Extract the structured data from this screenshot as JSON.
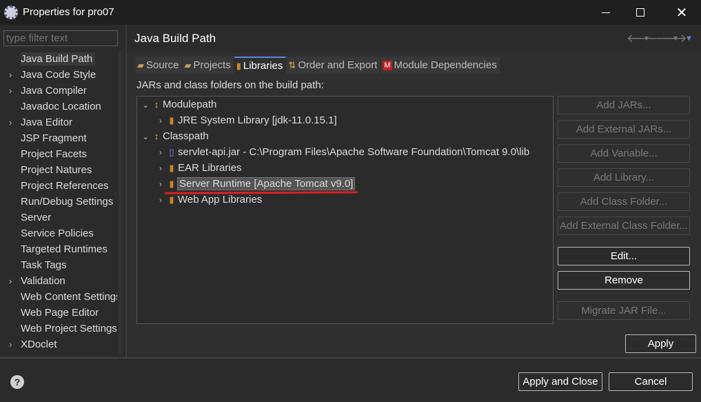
{
  "window": {
    "title": "Properties for pro07"
  },
  "filter": {
    "placeholder": "type filter text"
  },
  "nav": {
    "items": [
      {
        "label": "Java Build Path",
        "expandable": false,
        "selected": true
      },
      {
        "label": "Java Code Style",
        "expandable": true
      },
      {
        "label": "Java Compiler",
        "expandable": true
      },
      {
        "label": "Javadoc Location",
        "expandable": false
      },
      {
        "label": "Java Editor",
        "expandable": true
      },
      {
        "label": "JSP Fragment",
        "expandable": false
      },
      {
        "label": "Project Facets",
        "expandable": false
      },
      {
        "label": "Project Natures",
        "expandable": false
      },
      {
        "label": "Project References",
        "expandable": false
      },
      {
        "label": "Run/Debug Settings",
        "expandable": false
      },
      {
        "label": "Server",
        "expandable": false
      },
      {
        "label": "Service Policies",
        "expandable": false
      },
      {
        "label": "Targeted Runtimes",
        "expandable": false
      },
      {
        "label": "Task Tags",
        "expandable": false
      },
      {
        "label": "Validation",
        "expandable": true
      },
      {
        "label": "Web Content Settings",
        "expandable": false
      },
      {
        "label": "Web Page Editor",
        "expandable": false
      },
      {
        "label": "Web Project Settings",
        "expandable": false
      },
      {
        "label": "XDoclet",
        "expandable": true
      }
    ]
  },
  "page": {
    "title": "Java Build Path"
  },
  "tabs": [
    {
      "label": "Source",
      "icon": "folder-icon"
    },
    {
      "label": "Projects",
      "icon": "projects-icon"
    },
    {
      "label": "Libraries",
      "icon": "library-icon",
      "active": true
    },
    {
      "label": "Order and Export",
      "icon": "order-icon"
    },
    {
      "label": "Module Dependencies",
      "icon": "module-icon"
    }
  ],
  "section_label": "JARs and class folders on the build path:",
  "tree": {
    "modulepath": "Modulepath",
    "jre": "JRE System Library [jdk-11.0.15.1]",
    "classpath": "Classpath",
    "servlet": "servlet-api.jar - C:\\Program Files\\Apache Software Foundation\\Tomcat 9.0\\lib",
    "ear": "EAR Libraries",
    "runtime": "Server Runtime [Apache Tomcat v9.0]",
    "webapp": "Web App Libraries"
  },
  "buttons": {
    "add_jars": "Add JARs...",
    "add_external_jars": "Add External JARs...",
    "add_variable": "Add Variable...",
    "add_library": "Add Library...",
    "add_class_folder": "Add Class Folder...",
    "add_external_class_folder": "Add External Class Folder...",
    "edit": "Edit...",
    "remove": "Remove",
    "migrate_jar": "Migrate JAR File...",
    "apply": "Apply",
    "apply_and_close": "Apply and Close",
    "cancel": "Cancel"
  }
}
